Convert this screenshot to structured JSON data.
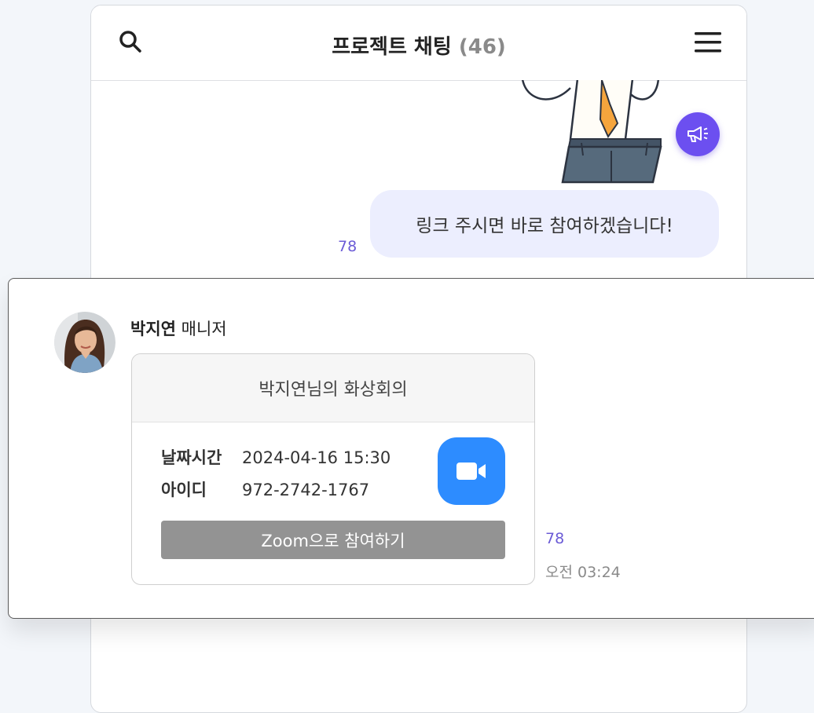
{
  "header": {
    "title": "프로젝트 채팅",
    "count": "(46)",
    "search_icon": "search-icon",
    "menu_icon": "hamburger-menu-icon"
  },
  "messages": {
    "outgoing": {
      "text": "링크 주시면 바로 참여하겠습니다!",
      "read_count": "78"
    },
    "incoming": {
      "sender_name": "박지연",
      "sender_role": "매니저",
      "card": {
        "title": "박지연님의 화상회의",
        "datetime_label": "날짜시간",
        "datetime_value": "2024-04-16 15:30",
        "id_label": "아이디",
        "id_value": "972-2742-1767",
        "join_label": "Zoom으로 참여하기"
      },
      "read_count": "78",
      "timestamp": "오전 03:24"
    }
  },
  "colors": {
    "accent": "#6c4ff0",
    "bubble_bg": "#eceefe",
    "zoom_blue": "#2d8cff",
    "join_button": "#939393",
    "read_count": "#6b5bd6"
  }
}
